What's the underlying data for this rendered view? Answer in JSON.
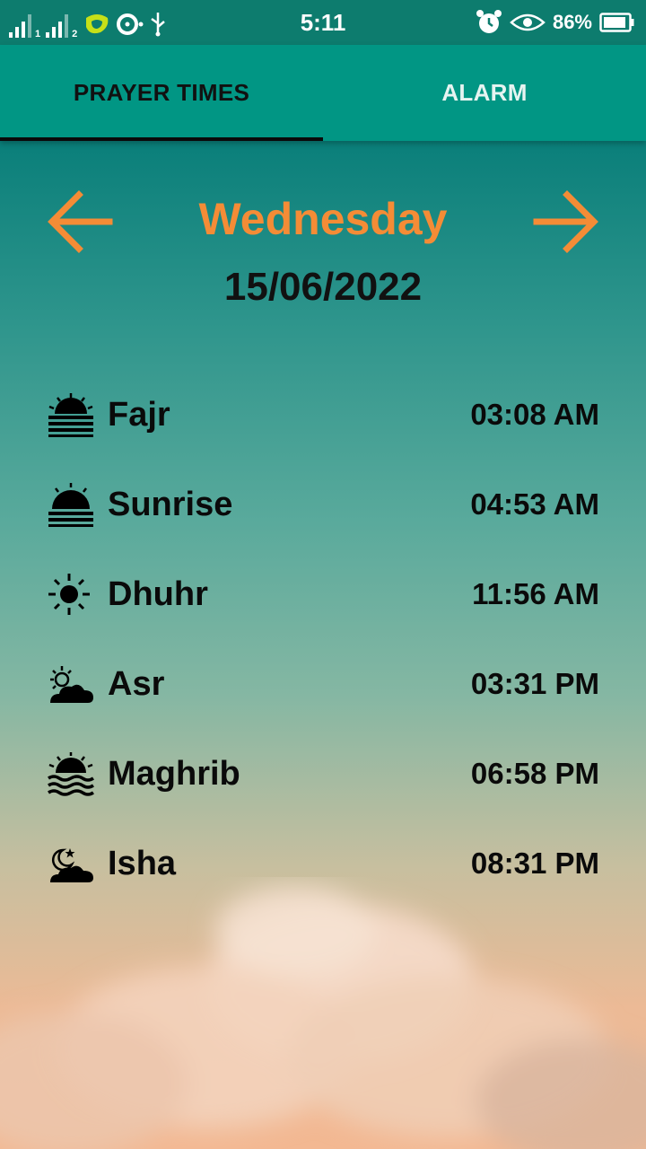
{
  "status_bar": {
    "sim1": "1",
    "sim2": "2",
    "time": "5:11",
    "battery": "86%",
    "icons": [
      "signal-icon",
      "signal-icon",
      "carrier-logo-icon",
      "disc-icon",
      "usb-icon",
      "alarm-clock-icon",
      "eye-icon",
      "battery-icon"
    ]
  },
  "tabs": [
    {
      "label": "PRAYER TIMES",
      "active": true
    },
    {
      "label": "ALARM",
      "active": false
    }
  ],
  "header": {
    "day": "Wednesday",
    "date": "15/06/2022",
    "prev_icon": "arrow-left-icon",
    "next_icon": "arrow-right-icon"
  },
  "prayers": [
    {
      "name": "Fajr",
      "time": "03:08 AM",
      "icon": "fajr-sunrise-lines-icon"
    },
    {
      "name": "Sunrise",
      "time": "04:53 AM",
      "icon": "sunrise-icon"
    },
    {
      "name": "Dhuhr",
      "time": "11:56 AM",
      "icon": "sun-icon"
    },
    {
      "name": "Asr",
      "time": "03:31 PM",
      "icon": "sun-cloud-icon"
    },
    {
      "name": "Maghrib",
      "time": "06:58 PM",
      "icon": "sunset-waves-icon"
    },
    {
      "name": "Isha",
      "time": "08:31 PM",
      "icon": "moon-cloud-icon"
    }
  ],
  "colors": {
    "status_bar": "#0d7c6e",
    "tab_bar": "#019684",
    "accent_orange": "#f48c36",
    "text_dark": "#111111"
  }
}
